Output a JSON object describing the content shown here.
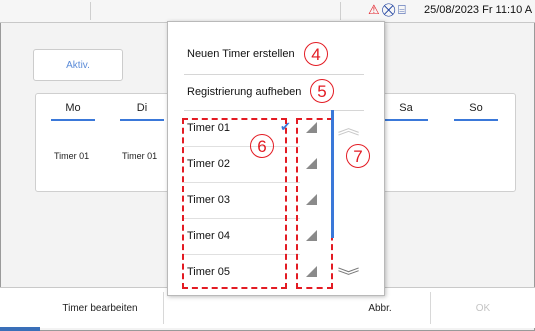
{
  "statusbar": {
    "datetime": "25/08/2023 Fr 11:10 A",
    "alarm_icon_color": "#e31b23",
    "network_icon_color": "#1c3f9e"
  },
  "background": {
    "mode_button_label": "Aktiv.",
    "days": [
      "Mo",
      "Di",
      "",
      "",
      "",
      "Sa",
      "So"
    ],
    "cells": [
      {
        "day": "Mo",
        "value": "Timer 01"
      },
      {
        "day": "Di",
        "value": "Timer 01"
      }
    ]
  },
  "bottom": {
    "edit_label": "Timer bearbeiten",
    "cancel_label": "Abbr.",
    "ok_label": "OK"
  },
  "menu": {
    "items": [
      {
        "label": "Neuen Timer erstellen",
        "callout": "4"
      },
      {
        "label": "Registrierung aufheben",
        "callout": "5"
      }
    ],
    "timers": [
      {
        "label": "Timer 01",
        "selected": true
      },
      {
        "label": "Timer 02",
        "selected": false
      },
      {
        "label": "Timer 03",
        "selected": false
      },
      {
        "label": "Timer 04",
        "selected": false
      },
      {
        "label": "Timer 05",
        "selected": false
      }
    ],
    "list_callout": "6",
    "expand_callout": "7",
    "accent_color": "#3a78d9",
    "annotation_color": "#e31b23"
  }
}
